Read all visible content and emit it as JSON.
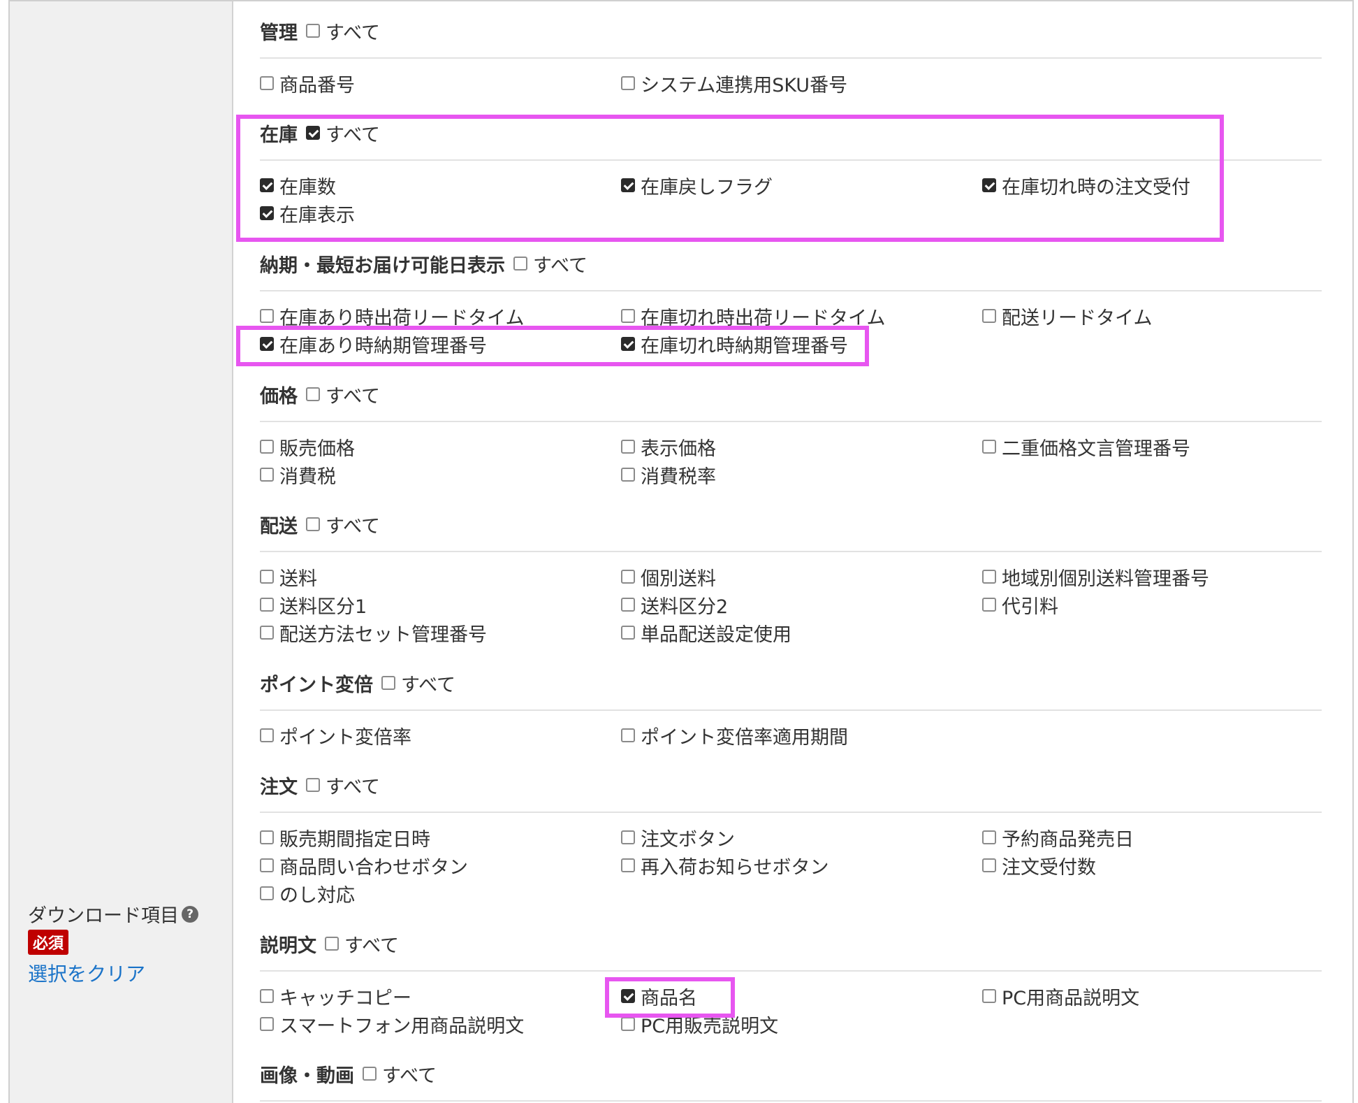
{
  "left": {
    "label": "ダウンロード項目",
    "help_icon": "question-circle-icon",
    "required": "必須",
    "clear_link": "選択をクリア"
  },
  "sections": {
    "kanri": {
      "title": "管理",
      "all_label": "すべて",
      "all_checked": false,
      "items": [
        {
          "label": "商品番号",
          "checked": false
        },
        {
          "label": "システム連携用SKU番号",
          "checked": false
        }
      ]
    },
    "zaiko": {
      "title": "在庫",
      "all_label": "すべて",
      "all_checked": true,
      "items": [
        {
          "label": "在庫数",
          "checked": true
        },
        {
          "label": "在庫戻しフラグ",
          "checked": true
        },
        {
          "label": "在庫切れ時の注文受付",
          "checked": true
        },
        {
          "label": "在庫表示",
          "checked": true
        }
      ]
    },
    "nouki": {
      "title": "納期・最短お届け可能日表示",
      "all_label": "すべて",
      "all_checked": false,
      "items": [
        {
          "label": "在庫あり時出荷リードタイム",
          "checked": false
        },
        {
          "label": "在庫切れ時出荷リードタイム",
          "checked": false
        },
        {
          "label": "配送リードタイム",
          "checked": false
        },
        {
          "label": "在庫あり時納期管理番号",
          "checked": true
        },
        {
          "label": "在庫切れ時納期管理番号",
          "checked": true
        }
      ]
    },
    "kakaku": {
      "title": "価格",
      "all_label": "すべて",
      "all_checked": false,
      "items": [
        {
          "label": "販売価格",
          "checked": false
        },
        {
          "label": "表示価格",
          "checked": false
        },
        {
          "label": "二重価格文言管理番号",
          "checked": false
        },
        {
          "label": "消費税",
          "checked": false
        },
        {
          "label": "消費税率",
          "checked": false
        }
      ]
    },
    "haisou": {
      "title": "配送",
      "all_label": "すべて",
      "all_checked": false,
      "items": [
        {
          "label": "送料",
          "checked": false
        },
        {
          "label": "個別送料",
          "checked": false
        },
        {
          "label": "地域別個別送料管理番号",
          "checked": false
        },
        {
          "label": "送料区分1",
          "checked": false
        },
        {
          "label": "送料区分2",
          "checked": false
        },
        {
          "label": "代引料",
          "checked": false
        },
        {
          "label": "配送方法セット管理番号",
          "checked": false
        },
        {
          "label": "単品配送設定使用",
          "checked": false
        }
      ]
    },
    "point": {
      "title": "ポイント変倍",
      "all_label": "すべて",
      "all_checked": false,
      "items": [
        {
          "label": "ポイント変倍率",
          "checked": false
        },
        {
          "label": "ポイント変倍率適用期間",
          "checked": false
        }
      ]
    },
    "chuumon": {
      "title": "注文",
      "all_label": "すべて",
      "all_checked": false,
      "items": [
        {
          "label": "販売期間指定日時",
          "checked": false
        },
        {
          "label": "注文ボタン",
          "checked": false
        },
        {
          "label": "予約商品発売日",
          "checked": false
        },
        {
          "label": "商品問い合わせボタン",
          "checked": false
        },
        {
          "label": "再入荷お知らせボタン",
          "checked": false
        },
        {
          "label": "注文受付数",
          "checked": false
        },
        {
          "label": "のし対応",
          "checked": false
        }
      ]
    },
    "setsumei": {
      "title": "説明文",
      "all_label": "すべて",
      "all_checked": false,
      "items": [
        {
          "label": "キャッチコピー",
          "checked": false
        },
        {
          "label": "商品名",
          "checked": true
        },
        {
          "label": "PC用商品説明文",
          "checked": false
        },
        {
          "label": "スマートフォン用商品説明文",
          "checked": false
        },
        {
          "label": "PC用販売説明文",
          "checked": false
        }
      ]
    },
    "gazou": {
      "title": "画像・動画",
      "all_label": "すべて",
      "all_checked": false,
      "items": []
    }
  },
  "colors": {
    "highlight": "#e756f0",
    "link": "#1a73c8",
    "required_badge": "#bf0000"
  }
}
